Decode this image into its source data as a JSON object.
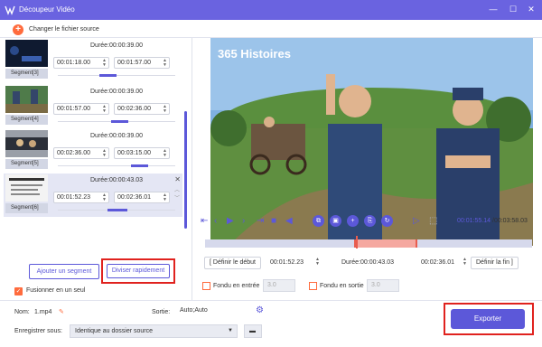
{
  "window": {
    "title": "Découpeur Vidéo"
  },
  "toolbar": {
    "change_source": "Changer le fichier source"
  },
  "segments": [
    {
      "label": "Segment[3]",
      "duration": "Durée:00:00:39.00",
      "start": "00:01:18.00",
      "end": "00:01:57.00",
      "progress_pct": 35
    },
    {
      "label": "Segment[4]",
      "duration": "Durée:00:00:39.00",
      "start": "00:01:57.00",
      "end": "00:02:36.00",
      "progress_pct": 52
    },
    {
      "label": "Segment[5]",
      "duration": "Durée:00:00:39.00",
      "start": "00:02:36.00",
      "end": "00:03:15.00",
      "progress_pct": 70
    },
    {
      "label": "Segment[6]",
      "duration": "Durée:00:00:43.03",
      "start": "00:01:52.23",
      "end": "00:02:36.01",
      "progress_pct": 48,
      "active": true
    }
  ],
  "actions": {
    "add_segment": "Ajouter un segment",
    "split_fast": "Diviser rapidement",
    "merge_label": "Fusionner en un seul"
  },
  "player": {
    "current_time": "00:01:55.14",
    "total_time": "/00:03:58.03",
    "watermark": "365 Histoires"
  },
  "trim": {
    "set_start": "Définir le début",
    "start_value": "00:01:52.23",
    "duration": "Durée:00:00:43.03",
    "end_value": "00:02:36.01",
    "set_end": "Définir la fin"
  },
  "fade": {
    "in_label": "Fondu en entrée",
    "in_value": "3.0",
    "out_label": "Fondu en sortie",
    "out_value": "3.0"
  },
  "output": {
    "name_label": "Nom:",
    "name_value": "1.mp4",
    "out_label": "Sortie:",
    "out_value": "Auto;Auto",
    "save_label": "Enregistrer sous:",
    "save_value": "Identique au dossier source",
    "export": "Exporter"
  },
  "colors": {
    "accent": "#5c58d9",
    "titlebar": "#6a63e0",
    "orange": "#ff6b3d",
    "highlight": "#e0221e"
  }
}
